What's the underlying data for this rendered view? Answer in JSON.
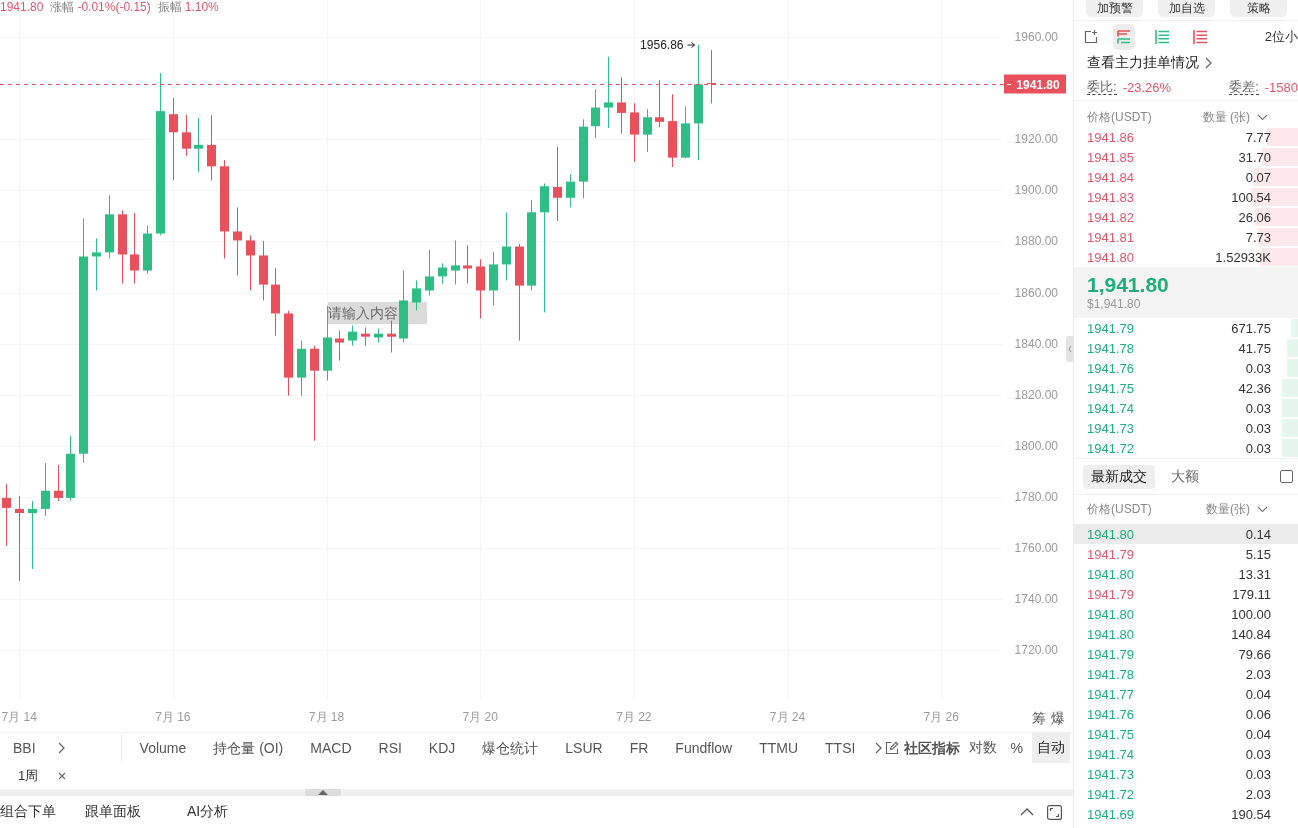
{
  "chart": {
    "quote_header": {
      "last": "1941.80",
      "change_label": "涨幅",
      "change": "-0.01%(-0.15)",
      "amplitude_label": "振幅",
      "amplitude": "1.10%"
    },
    "chart_data": {
      "type": "candlestick",
      "x": [
        "--07-13T20:00",
        "--07-14T00:00",
        "--07-14T04:00",
        "--07-14T08:00",
        "--07-14T12:00",
        "--07-14T16:00",
        "--07-14T20:00",
        "--07-15T00:00",
        "--07-15T04:00",
        "--07-15T08:00",
        "--07-15T12:00",
        "--07-15T16:00",
        "--07-15T20:00",
        "--07-16T00:00",
        "--07-16T04:00",
        "--07-16T08:00",
        "--07-16T12:00",
        "--07-16T16:00",
        "--07-16T20:00",
        "--07-17T00:00",
        "--07-17T04:00",
        "--07-17T08:00",
        "--07-17T12:00",
        "--07-17T16:00",
        "--07-17T20:00",
        "--07-18T00:00",
        "--07-18T04:00",
        "--07-18T08:00",
        "--07-18T12:00",
        "--07-18T16:00",
        "--07-18T20:00",
        "--07-19T00:00",
        "--07-19T04:00",
        "--07-19T08:00",
        "--07-19T12:00",
        "--07-19T16:00",
        "--07-19T20:00",
        "--07-20T00:00",
        "--07-20T04:00",
        "--07-20T08:00",
        "--07-20T12:00",
        "--07-20T16:00",
        "--07-20T20:00",
        "--07-21T00:00",
        "--07-21T04:00",
        "--07-21T08:00",
        "--07-21T12:00",
        "--07-21T16:00",
        "--07-21T20:00",
        "--07-22T00:00",
        "--07-22T04:00",
        "--07-22T08:00",
        "--07-22T12:00",
        "--07-22T16:00",
        "--07-22T20:00",
        "--07-23T00:00"
      ],
      "ohlc": [
        [
          1779.6,
          1785.1,
          1760.8,
          1775.7
        ],
        [
          1775.3,
          1780.4,
          1747.1,
          1773.7
        ],
        [
          1773.7,
          1778.4,
          1751.8,
          1775.3
        ],
        [
          1775.3,
          1793.3,
          1772.5,
          1782.4
        ],
        [
          1782.4,
          1792.5,
          1778.4,
          1779.6
        ],
        [
          1779.6,
          1803.9,
          1778.4,
          1796.9
        ],
        [
          1796.9,
          1889.0,
          1793.3,
          1874.1
        ],
        [
          1874.1,
          1881.2,
          1860.8,
          1875.7
        ],
        [
          1875.7,
          1898.0,
          1873.3,
          1890.6
        ],
        [
          1890.6,
          1892.2,
          1863.5,
          1874.9
        ],
        [
          1874.9,
          1891.1,
          1863.5,
          1868.6
        ],
        [
          1868.6,
          1886.3,
          1867.5,
          1883.1
        ],
        [
          1883.1,
          1945.9,
          1882.4,
          1931.0
        ],
        [
          1929.8,
          1936.1,
          1903.9,
          1922.7
        ],
        [
          1922.7,
          1929.6,
          1913.4,
          1916.3
        ],
        [
          1916.3,
          1928.3,
          1907.1,
          1917.8
        ],
        [
          1917.8,
          1929.4,
          1903.8,
          1909.4
        ],
        [
          1909.4,
          1911.8,
          1873.3,
          1883.9
        ],
        [
          1883.9,
          1893.3,
          1866.7,
          1880.4
        ],
        [
          1880.4,
          1882.4,
          1860.8,
          1874.5
        ],
        [
          1874.5,
          1880.2,
          1856.9,
          1863.1
        ],
        [
          1863.1,
          1869.7,
          1843.1,
          1851.8
        ],
        [
          1851.8,
          1852.9,
          1819.6,
          1826.7
        ],
        [
          1826.7,
          1841.2,
          1819.6,
          1838.0
        ],
        [
          1838.0,
          1839.2,
          1802.0,
          1829.4
        ],
        [
          1829.4,
          1854.8,
          1825.5,
          1842.4
        ],
        [
          1842.0,
          1845.1,
          1833.3,
          1840.4
        ],
        [
          1841.2,
          1847.1,
          1839.2,
          1844.7
        ],
        [
          1843.9,
          1846.3,
          1839.2,
          1842.7
        ],
        [
          1842.4,
          1845.9,
          1840.4,
          1843.9
        ],
        [
          1843.9,
          1849.0,
          1836.5,
          1842.7
        ],
        [
          1842.0,
          1868.6,
          1840.4,
          1856.9
        ],
        [
          1856.1,
          1864.7,
          1852.9,
          1861.6
        ],
        [
          1860.8,
          1876.7,
          1858.8,
          1866.3
        ],
        [
          1866.3,
          1871.4,
          1863.5,
          1869.8
        ],
        [
          1868.6,
          1880.4,
          1863.1,
          1870.6
        ],
        [
          1870.6,
          1878.5,
          1863.5,
          1869.4
        ],
        [
          1870.2,
          1873.0,
          1849.8,
          1860.8
        ],
        [
          1860.8,
          1876.0,
          1854.9,
          1871.0
        ],
        [
          1871.0,
          1891.3,
          1864.7,
          1878.0
        ],
        [
          1878.0,
          1879.0,
          1841.2,
          1862.7
        ],
        [
          1862.7,
          1896.1,
          1860.8,
          1891.4
        ],
        [
          1891.4,
          1902.7,
          1852.2,
          1901.6
        ],
        [
          1901.3,
          1917.1,
          1888.0,
          1897.1
        ],
        [
          1897.1,
          1906.3,
          1893.3,
          1903.4
        ],
        [
          1903.4,
          1927.8,
          1896.9,
          1924.9
        ],
        [
          1925.1,
          1939.6,
          1920.5,
          1932.4
        ],
        [
          1932.4,
          1952.3,
          1924.4,
          1934.4
        ],
        [
          1934.4,
          1944.2,
          1922.2,
          1930.3
        ],
        [
          1930.5,
          1934.1,
          1911.1,
          1921.8
        ],
        [
          1921.8,
          1931.8,
          1915.0,
          1928.6
        ],
        [
          1928.6,
          1943.1,
          1924.8,
          1926.8
        ],
        [
          1927.1,
          1937.6,
          1909.1,
          1912.8
        ],
        [
          1912.8,
          1932.9,
          1912.5,
          1926.2
        ],
        [
          1926.2,
          1956.86,
          1911.8,
          1941.5
        ],
        [
          1942.0,
          1954.9,
          1934.0,
          1941.8
        ]
      ],
      "xlim": [
        "--07-13T18:00",
        "--07-26T19:00"
      ],
      "ylim": [
        1700.5,
        1974.5
      ],
      "xticks": [
        {
          "value": "--07-14T00:00",
          "label": "7月 14"
        },
        {
          "value": "--07-16T00:00",
          "label": "7月 16"
        },
        {
          "value": "--07-18T00:00",
          "label": "7月 18"
        },
        {
          "value": "--07-20T00:00",
          "label": "7月 20"
        },
        {
          "value": "--07-22T00:00",
          "label": "7月 22"
        },
        {
          "value": "--07-24T00:00",
          "label": "7月 24"
        },
        {
          "value": "--07-26T00:00",
          "label": "7月 26"
        }
      ],
      "yticks": [
        {
          "value": 1720,
          "label": "1720.00"
        },
        {
          "value": 1740,
          "label": "1740.00"
        },
        {
          "value": 1760,
          "label": "1760.00"
        },
        {
          "value": 1780,
          "label": "1780.00"
        },
        {
          "value": 1800,
          "label": "1800.00"
        },
        {
          "value": 1820,
          "label": "1820.00"
        },
        {
          "value": 1840,
          "label": "1840.00"
        },
        {
          "value": 1860,
          "label": "1860.00"
        },
        {
          "value": 1880,
          "label": "1880.00"
        },
        {
          "value": 1900,
          "label": "1900.00"
        },
        {
          "value": 1920,
          "label": "1920.00"
        },
        {
          "value": 1960,
          "label": "1960.00"
        }
      ],
      "grid": true,
      "ref_lines": [
        {
          "axis": "y",
          "value": 1941.8,
          "label": "1941.80",
          "color": "#e8505b",
          "line_style": "dashed"
        }
      ],
      "annotations": [
        "1956.86"
      ]
    },
    "text_input": {
      "placeholder": "请输入内容"
    },
    "axis_buttons": [
      "筹",
      "爆"
    ]
  },
  "indicator_toolbar": {
    "main_indicators": [
      "BBI"
    ],
    "sub_indicators": [
      "Volume",
      "持仓量 (OI)",
      "MACD",
      "RSI",
      "KDJ",
      "爆仓统计",
      "LSUR",
      "FR",
      "Fundflow",
      "TTMU",
      "TTSI"
    ],
    "community": "社区指标",
    "scale_modes": [
      {
        "label": "对数",
        "selected": false
      },
      {
        "label": "%",
        "selected": false
      },
      {
        "label": "自动",
        "selected": true
      }
    ]
  },
  "interval_tags": [
    "1周"
  ],
  "bottom_tabs": [
    "组合下单",
    "跟单面板",
    "AI分析"
  ],
  "order_panel": {
    "top_buttons": [
      "加预警",
      "加自选",
      "策略"
    ],
    "view_modes": [
      {
        "kind": "both",
        "selected": true
      },
      {
        "kind": "bids",
        "selected": false
      },
      {
        "kind": "asks",
        "selected": false
      }
    ],
    "precision": "2位小",
    "main_orders_link": "查看主力挂单情况",
    "ratio_label": "委比:",
    "ratio": "-23.26%",
    "diff_label": "委差:",
    "diff": "-1580",
    "columns": [
      "价格(USDT)",
      "数量 (张)"
    ],
    "asks": [
      {
        "price": "1941.86",
        "amount": "7.77",
        "level": 0.14
      },
      {
        "price": "1941.85",
        "amount": "31.70",
        "level": 0.16
      },
      {
        "price": "1941.84",
        "amount": "0.07",
        "level": 0.2
      },
      {
        "price": "1941.83",
        "amount": "100.54",
        "level": 0.21
      },
      {
        "price": "1941.82",
        "amount": "26.06",
        "level": 0.19
      },
      {
        "price": "1941.81",
        "amount": "7.73",
        "level": 0.18
      },
      {
        "price": "1941.80",
        "amount": "1.52933K",
        "level": 0.17
      }
    ],
    "last_price": "1,941.80",
    "last_price_usd": "$1,941.80",
    "bids": [
      {
        "price": "1941.79",
        "amount": "671.75",
        "level": 0.03
      },
      {
        "price": "1941.78",
        "amount": "41.75",
        "level": 0.05
      },
      {
        "price": "1941.76",
        "amount": "0.03",
        "level": 0.05
      },
      {
        "price": "1941.75",
        "amount": "42.36",
        "level": 0.07
      },
      {
        "price": "1941.74",
        "amount": "0.03",
        "level": 0.07
      },
      {
        "price": "1941.73",
        "amount": "0.03",
        "level": 0.07
      },
      {
        "price": "1941.72",
        "amount": "0.03",
        "level": 0.07
      }
    ]
  },
  "trades_panel": {
    "tabs": [
      {
        "label": "最新成交",
        "selected": true
      },
      {
        "label": "大额",
        "selected": false
      }
    ],
    "checkbox": {
      "checked": false
    },
    "columns": [
      "价格(USDT)",
      "数量(张)"
    ],
    "rows": [
      {
        "price": "1941.80",
        "amount": "0.14",
        "kind": "buy",
        "highlighted": true
      },
      {
        "price": "1941.79",
        "amount": "5.15",
        "kind": "sell",
        "highlighted": false
      },
      {
        "price": "1941.80",
        "amount": "13.31",
        "kind": "buy",
        "highlighted": false
      },
      {
        "price": "1941.79",
        "amount": "179.11",
        "kind": "sell",
        "highlighted": false
      },
      {
        "price": "1941.80",
        "amount": "100.00",
        "kind": "buy",
        "highlighted": false
      },
      {
        "price": "1941.80",
        "amount": "140.84",
        "kind": "buy",
        "highlighted": false
      },
      {
        "price": "1941.79",
        "amount": "79.66",
        "kind": "buy",
        "highlighted": false
      },
      {
        "price": "1941.78",
        "amount": "2.03",
        "kind": "buy",
        "highlighted": false
      },
      {
        "price": "1941.77",
        "amount": "0.04",
        "kind": "buy",
        "highlighted": false
      },
      {
        "price": "1941.76",
        "amount": "0.06",
        "kind": "buy",
        "highlighted": false
      },
      {
        "price": "1941.75",
        "amount": "0.04",
        "kind": "buy",
        "highlighted": false
      },
      {
        "price": "1941.74",
        "amount": "0.03",
        "kind": "buy",
        "highlighted": false
      },
      {
        "price": "1941.73",
        "amount": "0.03",
        "kind": "buy",
        "highlighted": false
      },
      {
        "price": "1941.72",
        "amount": "2.03",
        "kind": "buy",
        "highlighted": false
      },
      {
        "price": "1941.69",
        "amount": "190.54",
        "kind": "buy",
        "highlighted": false
      }
    ]
  }
}
